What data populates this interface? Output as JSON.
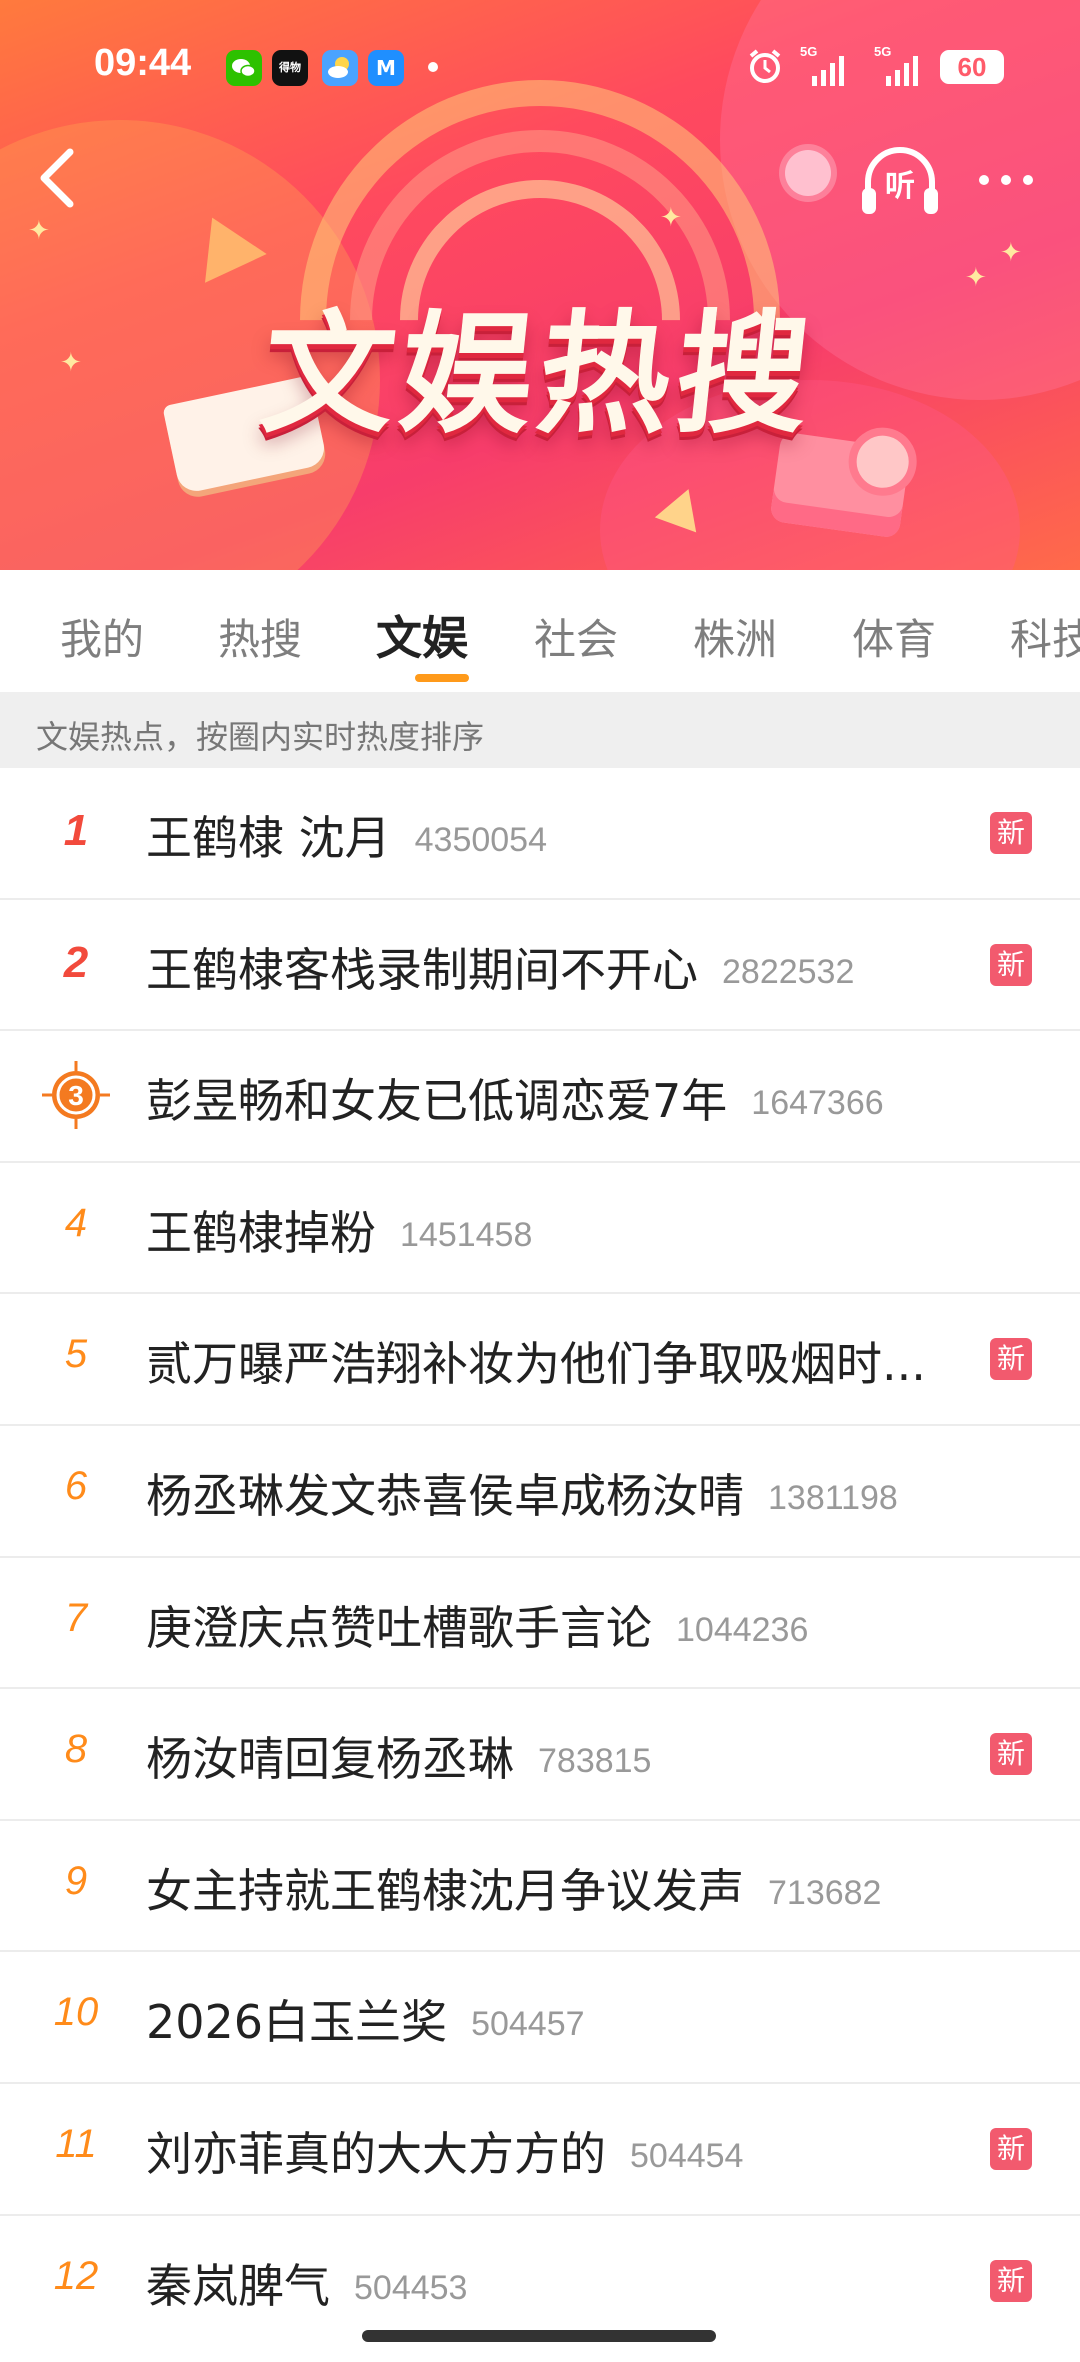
{
  "status_bar": {
    "time": "09:44",
    "app_icons": [
      "wechat-icon",
      "dewu-icon",
      "weather-icon",
      "m-app-icon"
    ],
    "network": [
      "5G",
      "5G"
    ],
    "battery": "60"
  },
  "banner": {
    "title": "文娱热搜",
    "listen_label": "听",
    "colors": {
      "gradient_start": "#ff7a3d",
      "gradient_mid": "#f73d6b",
      "title_shadow": "#e0283f"
    }
  },
  "tabs": {
    "items": [
      {
        "label": "我的"
      },
      {
        "label": "热搜"
      },
      {
        "label": "文娱"
      },
      {
        "label": "社会"
      },
      {
        "label": "株洲"
      },
      {
        "label": "体育"
      },
      {
        "label": "科技"
      }
    ],
    "active": "文娱",
    "accent_color": "#ff9a1a"
  },
  "subheader": {
    "text": "文娱热点，按圈内实时热度排序"
  },
  "list": {
    "new_badge": "新",
    "items": [
      {
        "rank": "1",
        "title": "王鹤棣 沈月",
        "count": "4350054",
        "is_new": true
      },
      {
        "rank": "2",
        "title": "王鹤棣客栈录制期间不开心",
        "count": "2822532",
        "is_new": true
      },
      {
        "rank": "3",
        "title": "彭昱畅和女友已低调恋爱7年",
        "count": "1647366",
        "is_new": false
      },
      {
        "rank": "4",
        "title": "王鹤棣掉粉",
        "count": "1451458",
        "is_new": false
      },
      {
        "rank": "5",
        "title": "贰万曝严浩翔补妆为他们争取吸烟时...",
        "count": "",
        "is_new": true
      },
      {
        "rank": "6",
        "title": "杨丞琳发文恭喜侯卓成杨汝晴",
        "count": "1381198",
        "is_new": false
      },
      {
        "rank": "7",
        "title": "庚澄庆点赞吐槽歌手言论",
        "count": "1044236",
        "is_new": false
      },
      {
        "rank": "8",
        "title": "杨汝晴回复杨丞琳",
        "count": "783815",
        "is_new": true
      },
      {
        "rank": "9",
        "title": "女主持就王鹤棣沈月争议发声",
        "count": "713682",
        "is_new": false
      },
      {
        "rank": "10",
        "title": "2026白玉兰奖",
        "count": "504457",
        "is_new": false
      },
      {
        "rank": "11",
        "title": "刘亦菲真的大大方方的",
        "count": "504454",
        "is_new": true
      },
      {
        "rank": "12",
        "title": "秦岚脾气",
        "count": "504453",
        "is_new": true
      }
    ]
  }
}
